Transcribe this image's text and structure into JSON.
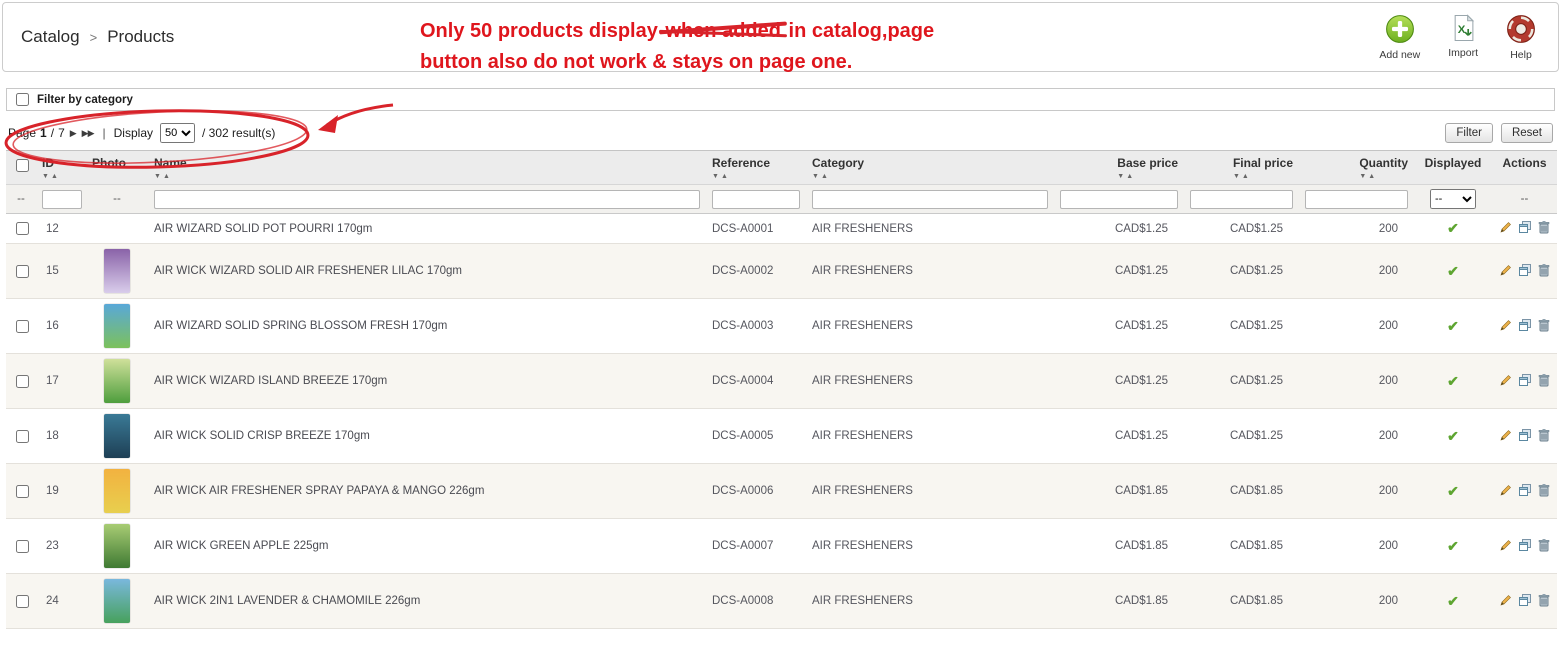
{
  "breadcrumb": {
    "section": "Catalog",
    "separator": ">",
    "page": "Products"
  },
  "annotation": {
    "line1_before": "Only 50 products display ",
    "line1_struck": "when added",
    "line1_after": " in catalog,page",
    "line2": "button also do not work & stays on page one.",
    "color": "#d8232a"
  },
  "toolbar": {
    "add_new_label": "Add new",
    "import_label": "Import",
    "help_label": "Help"
  },
  "category_filter": {
    "label": "Filter by category"
  },
  "pagination": {
    "page_label": "Page",
    "current_page": "1",
    "page_separator": "/",
    "total_pages": "7",
    "divider": "|",
    "display_label": "Display",
    "display_options": [
      "50"
    ],
    "display_selected": "50",
    "results_text": "/ 302 result(s)"
  },
  "buttons": {
    "filter": "Filter",
    "reset": "Reset"
  },
  "icons": {
    "add_new": "green-plus-circle",
    "import": "excel-document-with-green-arrow",
    "help": "red-lifebuoy",
    "sort_desc": "▼",
    "sort_asc": "▲",
    "page_next": "▶",
    "page_last": "▶▶",
    "displayed_check": "✔",
    "edit": "pencil",
    "duplicate": "overlapping-windows",
    "delete": "trash-can"
  },
  "table": {
    "headers": [
      {
        "label": "ID",
        "sortable": true
      },
      {
        "label": "Photo",
        "sortable": false
      },
      {
        "label": "Name",
        "sortable": true
      },
      {
        "label": "Reference",
        "sortable": true
      },
      {
        "label": "Category",
        "sortable": true
      },
      {
        "label": "Base price",
        "sortable": true
      },
      {
        "label": "Final price",
        "sortable": true
      },
      {
        "label": "Quantity",
        "sortable": true
      },
      {
        "label": "Displayed",
        "sortable": false
      },
      {
        "label": "Actions",
        "sortable": false
      }
    ],
    "filter": {
      "empty_marker": "--",
      "displayed_value": "--"
    },
    "rows": [
      {
        "id": "12",
        "name": "AIR WIZARD SOLID POT POURRI 170gm",
        "reference": "DCS-A0001",
        "category": "AIR FRESHENERS",
        "base_price": "CAD$1.25",
        "final_price": "CAD$1.25",
        "quantity": "200",
        "displayed": true,
        "photo_colors": null
      },
      {
        "id": "15",
        "name": "AIR WICK WIZARD SOLID AIR FRESHENER LILAC 170gm",
        "reference": "DCS-A0002",
        "category": "AIR FRESHENERS",
        "base_price": "CAD$1.25",
        "final_price": "CAD$1.25",
        "quantity": "200",
        "displayed": true,
        "photo_colors": [
          "#8a63a8",
          "#d9cdeb"
        ]
      },
      {
        "id": "16",
        "name": "AIR WIZARD SOLID SPRING BLOSSOM FRESH 170gm",
        "reference": "DCS-A0003",
        "category": "AIR FRESHENERS",
        "base_price": "CAD$1.25",
        "final_price": "CAD$1.25",
        "quantity": "200",
        "displayed": true,
        "photo_colors": [
          "#59a8d8",
          "#7cc15c"
        ]
      },
      {
        "id": "17",
        "name": "AIR WICK WIZARD ISLAND BREEZE 170gm",
        "reference": "DCS-A0004",
        "category": "AIR FRESHENERS",
        "base_price": "CAD$1.25",
        "final_price": "CAD$1.25",
        "quantity": "200",
        "displayed": true,
        "photo_colors": [
          "#cfe09a",
          "#4e9e3d"
        ]
      },
      {
        "id": "18",
        "name": "AIR WICK SOLID CRISP BREEZE 170gm",
        "reference": "DCS-A0005",
        "category": "AIR FRESHENERS",
        "base_price": "CAD$1.25",
        "final_price": "CAD$1.25",
        "quantity": "200",
        "displayed": true,
        "photo_colors": [
          "#3a7a96",
          "#1e3f55"
        ]
      },
      {
        "id": "19",
        "name": "AIR WICK AIR FRESHENER SPRAY PAPAYA & MANGO 226gm",
        "reference": "DCS-A0006",
        "category": "AIR FRESHENERS",
        "base_price": "CAD$1.85",
        "final_price": "CAD$1.85",
        "quantity": "200",
        "displayed": true,
        "photo_colors": [
          "#f2b240",
          "#e8cf4e"
        ]
      },
      {
        "id": "23",
        "name": "AIR WICK GREEN APPLE 225gm",
        "reference": "DCS-A0007",
        "category": "AIR FRESHENERS",
        "base_price": "CAD$1.85",
        "final_price": "CAD$1.85",
        "quantity": "200",
        "displayed": true,
        "photo_colors": [
          "#a8cc74",
          "#3f7a33"
        ]
      },
      {
        "id": "24",
        "name": "AIR WICK 2IN1 LAVENDER & CHAMOMILE 226gm",
        "reference": "DCS-A0008",
        "category": "AIR FRESHENERS",
        "base_price": "CAD$1.85",
        "final_price": "CAD$1.85",
        "quantity": "200",
        "displayed": true,
        "photo_colors": [
          "#7ab8dd",
          "#47a15c"
        ]
      }
    ]
  }
}
